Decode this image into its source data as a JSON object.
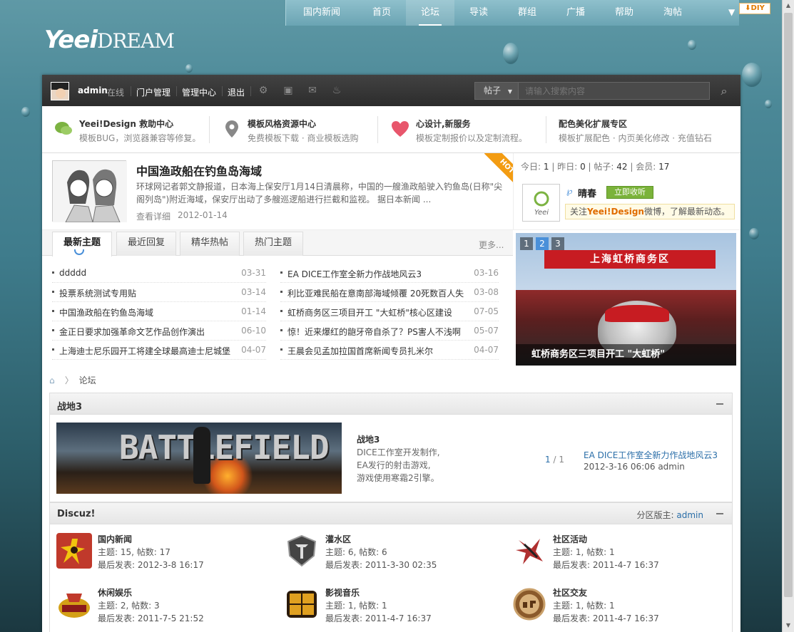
{
  "nav": {
    "items": [
      {
        "label": "国内新闻",
        "wide": true
      },
      {
        "label": "首页"
      },
      {
        "label": "论坛",
        "active": true
      },
      {
        "label": "导读"
      },
      {
        "label": "群组"
      },
      {
        "label": "广播"
      },
      {
        "label": "帮助"
      },
      {
        "label": "淘帖"
      }
    ],
    "diy": "⬇DIY"
  },
  "logo": {
    "part1": "Yeei",
    "part2": "DREAM"
  },
  "userbar": {
    "username": "admin",
    "status": "在线",
    "links": [
      "门户管理",
      "管理中心",
      "退出"
    ],
    "search_type": "帖子",
    "search_placeholder": "请输入搜索内容"
  },
  "promo": [
    {
      "title": "Yeei!Design 救助中心",
      "desc": "模板BUG，浏览器兼容等修复。",
      "icon": "chat-bubble-icon",
      "color": "#7cb342"
    },
    {
      "title": "模板风格资源中心",
      "desc": "免费模板下载 · 商业模板选购",
      "icon": "map-pin-icon",
      "color": "#888888"
    },
    {
      "title": "心设计,新服务",
      "desc": "模板定制报价以及定制流程。",
      "icon": "heart-icon",
      "color": "#e8566c"
    },
    {
      "title": "配色美化扩展专区",
      "desc": "模板扩展配色 · 内页美化修改 · 充值钻石",
      "icon": "",
      "color": ""
    }
  ],
  "headline": {
    "title": "中国渔政船在钓鱼岛海域",
    "desc": "环球网记者郭文静报道，日本海上保安厅1月14日清晨称，中国的一艘渔政船驶入钓鱼岛(日称\"尖阁列岛\")附近海域，保安厅出动了多艘巡逻船进行拦截和监视。 据日本新闻 ...",
    "more": "查看详细",
    "date": "2012-01-14",
    "badge": "HOT"
  },
  "stats": {
    "today_label": "今日:",
    "today": "1",
    "yesterday_label": "昨日:",
    "yesterday": "0",
    "posts_label": "帖子:",
    "posts": "42",
    "members_label": "会员:",
    "members": "17"
  },
  "weibo": {
    "name": "晴春",
    "follow": "立即收听",
    "tip_pre": "关注",
    "tip_brand": "Yeei!Design",
    "tip_post": "微博，了解最新动态。",
    "logo_text": "Yeei"
  },
  "tabs": {
    "items": [
      "最新主题",
      "最近回复",
      "精华热帖",
      "热门主题"
    ],
    "more": "更多..."
  },
  "threads_left": [
    {
      "title": "ddddd",
      "date": "03-31"
    },
    {
      "title": "投票系统测试专用贴",
      "date": "03-14"
    },
    {
      "title": "中国渔政船在钓鱼岛海域",
      "date": "01-14"
    },
    {
      "title": "金正日要求加强革命文艺作品创作演出",
      "date": "06-10"
    },
    {
      "title": "上海迪士尼乐园开工将建全球最高迪士尼城堡",
      "date": "04-07"
    }
  ],
  "threads_right": [
    {
      "title": "EA DICE工作室全新力作战地风云3",
      "date": "03-16"
    },
    {
      "title": "利比亚难民船在意南部海域倾覆 20死数百人失",
      "date": "03-08"
    },
    {
      "title": "虹桥商务区三项目开工 \"大虹桥\"核心区建设",
      "date": "07-05"
    },
    {
      "title": "惊！近来爆红的龅牙帝自杀了？PS害人不浅啊",
      "date": "05-07"
    },
    {
      "title": "王晨会见孟加拉国首席新闻专员扎米尔",
      "date": "04-07"
    }
  ],
  "slideshow": {
    "nums": [
      "1",
      "2",
      "3"
    ],
    "active": 1,
    "caption": "虹桥商务区三项目开工 \"大虹桥\"",
    "banner": "上海虹桥商务区"
  },
  "breadcrumb": {
    "current": "论坛",
    "sep": "〉"
  },
  "forum1": {
    "title": "战地3",
    "banner_text": "BATTLEFIELD",
    "name": "战地3",
    "desc_lines": [
      "DICE工作室开发制作,",
      "EA发行的射击游戏,",
      "游戏使用寒霜2引擎。"
    ],
    "page_cur": "1",
    "page_total": "/ 1",
    "last_title": "EA DICE工作室全新力作战地风云3",
    "last_meta": "2012-3-16 06:06 admin"
  },
  "forum2": {
    "title": "Discuz!",
    "mod_label": "分区版主:",
    "mod_name": "admin",
    "boards": [
      {
        "name": "国内新闻",
        "stat": "主题: 15, 帖数: 17",
        "last": "最后发表: 2012-3-8 16:17",
        "icon": "news-icon",
        "color": "#c0392b"
      },
      {
        "name": "灌水区",
        "stat": "主题: 6, 帖数: 6",
        "last": "最后发表: 2011-3-30 02:35",
        "icon": "tank-shield-icon",
        "color": "#555555"
      },
      {
        "name": "社区活动",
        "stat": "主题: 1, 帖数: 1",
        "last": "最后发表: 2011-4-7 16:37",
        "icon": "warrior-icon",
        "color": "#b03030"
      },
      {
        "name": "休闲娱乐",
        "stat": "主题: 2, 帖数: 3",
        "last": "最后发表: 2011-7-5 21:52",
        "icon": "game-logo-icon",
        "color": "#d4a017"
      },
      {
        "name": "影视音乐",
        "stat": "主题: 1, 帖数: 1",
        "last": "最后发表: 2011-4-7 16:37",
        "icon": "film-logo-icon",
        "color": "#e0a020"
      },
      {
        "name": "社区交友",
        "stat": "主题: 1, 帖数: 1",
        "last": "最后发表: 2011-4-7 16:37",
        "icon": "dnf-logo-icon",
        "color": "#8a5a2b"
      }
    ]
  }
}
